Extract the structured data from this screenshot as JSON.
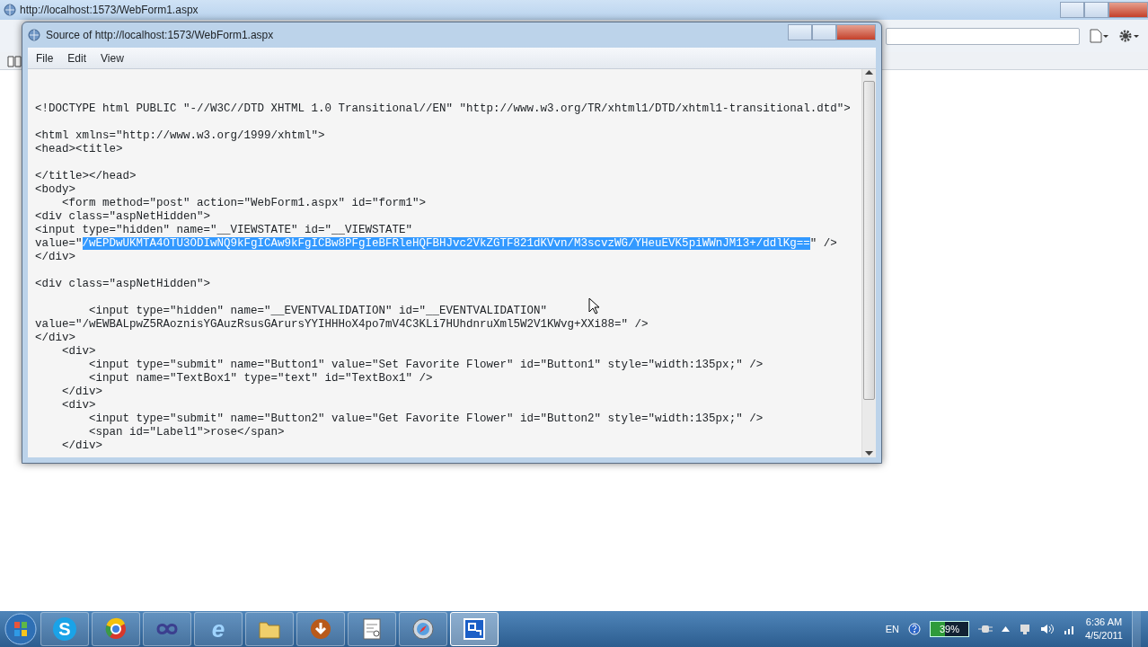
{
  "browser": {
    "title": "http://localhost:1573/WebForm1.aspx"
  },
  "source_window": {
    "title": "Source of http://localhost:1573/WebForm1.aspx",
    "menu": [
      "File",
      "Edit",
      "View"
    ],
    "code_groups": [
      [
        {
          "text": "<!DOCTYPE html PUBLIC \"-//W3C//DTD XHTML 1.0 Transitional//EN\" \"http://www.w3.org/TR/xhtml1/DTD/xhtml1-transitional.dtd\">"
        }
      ],
      [
        {
          "text": "<html xmlns=\"http://www.w3.org/1999/xhtml\">"
        },
        {
          "text": "<head><title>"
        }
      ],
      [
        {
          "text": "</title></head>"
        },
        {
          "text": "<body>"
        },
        {
          "text": "    <form method=\"post\" action=\"WebForm1.aspx\" id=\"form1\">"
        },
        {
          "text": "<div class=\"aspNetHidden\">"
        },
        {
          "text": "<input type=\"hidden\" name=\"__VIEWSTATE\" id=\"__VIEWSTATE\""
        },
        {
          "text": "value=\"",
          "selected_text": "/wEPDwUKMTA4OTU3ODIwNQ9kFgICAw9kFgICBw8PFgIeBFRleHQFBHJvc2VkZGTF821dKVvn/M3scvzWG/YHeuEVK5piWWnJM13+/ddlKg==",
          "after": "\" />"
        },
        {
          "text": "</div>"
        }
      ],
      [
        {
          "text": "<div class=\"aspNetHidden\">"
        }
      ],
      [
        {
          "text": "        <input type=\"hidden\" name=\"__EVENTVALIDATION\" id=\"__EVENTVALIDATION\""
        },
        {
          "text": "value=\"/wEWBALpwZ5RAoznisYGAuzRsusGArursYYIHHHoX4po7mV4C3KLi7HUhdnruXml5W2V1KWvg+XXi88=\" />"
        },
        {
          "text": "</div>"
        },
        {
          "text": "    <div>"
        },
        {
          "text": "        <input type=\"submit\" name=\"Button1\" value=\"Set Favorite Flower\" id=\"Button1\" style=\"width:135px;\" />"
        },
        {
          "text": "        <input name=\"TextBox1\" type=\"text\" id=\"TextBox1\" />"
        },
        {
          "text": "    </div>"
        },
        {
          "text": "    <div>"
        },
        {
          "text": "        <input type=\"submit\" name=\"Button2\" value=\"Get Favorite Flower\" id=\"Button2\" style=\"width:135px;\" />"
        },
        {
          "text": "        <span id=\"Label1\">rose</span>"
        },
        {
          "text": "    </div>"
        }
      ]
    ]
  },
  "taskbar": {
    "items": [
      {
        "kind": "letter",
        "label": "S",
        "selected": false
      },
      {
        "kind": "ring",
        "selected": false
      },
      {
        "kind": "loops",
        "selected": false
      },
      {
        "kind": "globe",
        "label": "e",
        "selected": false
      },
      {
        "kind": "folder",
        "selected": false
      },
      {
        "kind": "download",
        "selected": false
      },
      {
        "kind": "document",
        "selected": false
      },
      {
        "kind": "compass",
        "selected": false
      },
      {
        "kind": "window",
        "selected": true
      }
    ],
    "language": "EN",
    "battery": {
      "label": "39%",
      "level": 0.39
    },
    "time": "6:36 AM",
    "date": "4/5/2011"
  }
}
